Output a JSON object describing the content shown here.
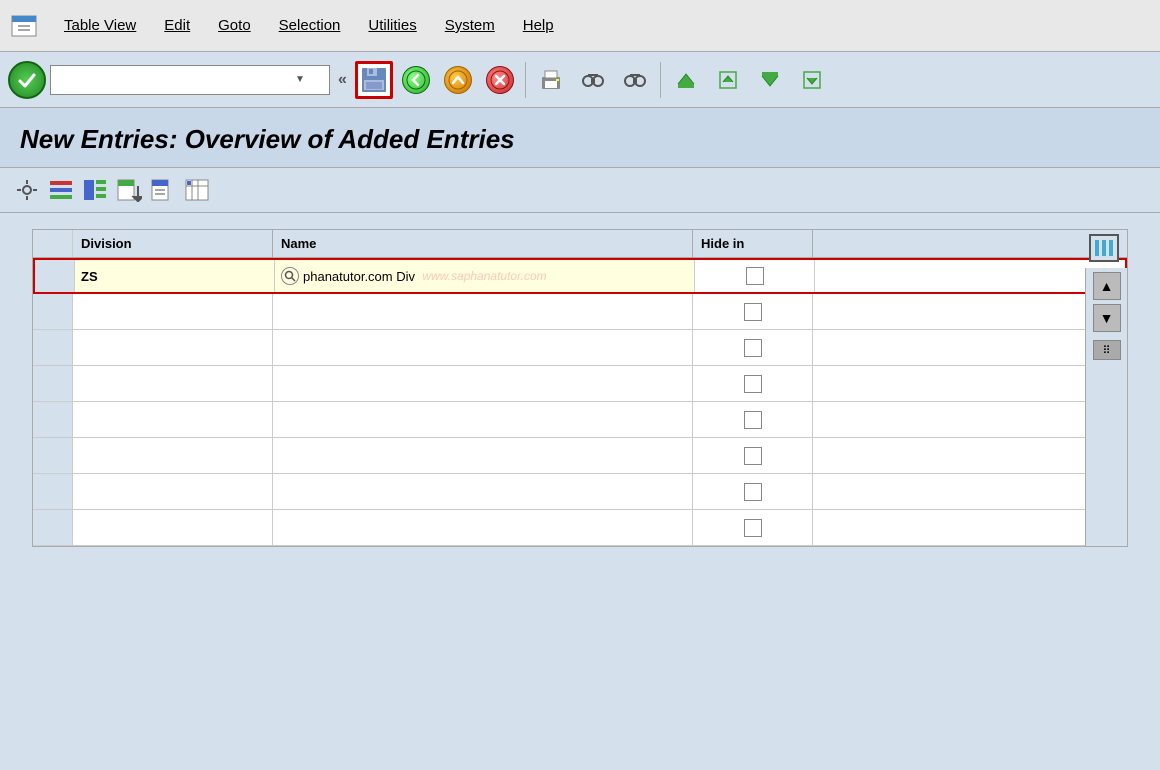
{
  "menubar": {
    "items": [
      {
        "id": "table-view",
        "label": "Table View"
      },
      {
        "id": "edit",
        "label": "Edit"
      },
      {
        "id": "goto",
        "label": "Goto"
      },
      {
        "id": "selection",
        "label": "Selection"
      },
      {
        "id": "utilities",
        "label": "Utilities"
      },
      {
        "id": "system",
        "label": "System"
      },
      {
        "id": "help",
        "label": "Help"
      }
    ]
  },
  "toolbar": {
    "command_placeholder": "",
    "save_label": "💾",
    "back_label": "◀",
    "cancel_label": "✕"
  },
  "page": {
    "title": "New Entries: Overview of Added Entries"
  },
  "secondary_toolbar": {
    "buttons": [
      "⚙",
      "📋",
      "📄",
      "📄",
      "📄",
      "📄"
    ]
  },
  "table": {
    "columns": [
      {
        "id": "division",
        "label": "Division"
      },
      {
        "id": "name",
        "label": "Name"
      },
      {
        "id": "hidein",
        "label": "Hide in"
      }
    ],
    "rows": [
      {
        "division": "ZS",
        "name": "phanatutor.com Div",
        "hidein": false,
        "active": true
      },
      {
        "division": "",
        "name": "",
        "hidein": false,
        "active": false
      },
      {
        "division": "",
        "name": "",
        "hidein": false,
        "active": false
      },
      {
        "division": "",
        "name": "",
        "hidein": false,
        "active": false
      },
      {
        "division": "",
        "name": "",
        "hidein": false,
        "active": false
      },
      {
        "division": "",
        "name": "",
        "hidein": false,
        "active": false
      },
      {
        "division": "",
        "name": "",
        "hidein": false,
        "active": false
      },
      {
        "division": "",
        "name": "",
        "hidein": false,
        "active": false
      }
    ],
    "watermark": "www.saphanatutor.com"
  },
  "colors": {
    "accent_red": "#cc0000",
    "bg_main": "#d4e0ec",
    "bg_header": "#c8d8e8"
  }
}
